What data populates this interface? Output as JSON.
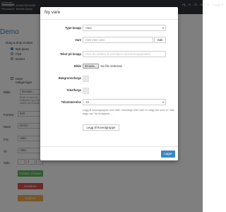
{
  "header": {
    "admin_link": "Administr...",
    "company_line": "Sentralenr.: 9100079000000",
    "firm_line": "Firmanavn: Testvirk Demo",
    "nav_text": "Hj...  K...  O...  Admin...  Logg ut"
  },
  "background": {
    "title": "Demo",
    "dragdrop_label": "Drag & drop modus",
    "radio_options": [
      "Bytt plass",
      "Flytt",
      "Endret"
    ],
    "checkbox_label_1": "Have",
    "checkbox_label_2": "redigeringer",
    "image_label": "Bilde",
    "browse_label": "Browse...",
    "image_help": "Bilder er bare for knappene og vil bli skalert med høyde",
    "format_label": "Format",
    "format_value": "9x0",
    "name_label": "Navn",
    "name_value": "Demo",
    "from_label": "Fra",
    "from_value": "Aktiv",
    "to_label": "Til",
    "to_value": "Aktiv",
    "page_label": "Side",
    "page_value": "1",
    "btn_green": "Publiser til kasse",
    "btn_red": "Deaktiver",
    "btn_yellow": "Dupliser",
    "colors": {
      "green": "#5cb85c",
      "red": "#d9534f",
      "yellow": "#f0ad4e"
    }
  },
  "modal": {
    "title": "Ny vare",
    "type_label": "Type knapp",
    "type_value": "Vare",
    "vare_label": "Vare",
    "vare_placeholder": "Søk etter vare",
    "search_button": "Søk",
    "text_label": "Tekst på knapp",
    "text_placeholder": "Hvis du ønsker å overstyre normal knappetekst",
    "image_label": "Bilde",
    "browse_label": "Browse...",
    "no_file": "No file selected.",
    "bg_color_label": "Bakgrunnsfarge",
    "text_color_label": "Tekstfarge",
    "font_size_label": "Tekststørrelse",
    "font_size_value": "10",
    "help_text": "Legg til hovedgrupper som ikke i tekstlege eller vare er valgt (Se ovre er \"Alle ekgo var\" for knappen) ...",
    "add_group_button": "Legg til hovedgruppe",
    "save_button": "Lagre",
    "accent": "#3a86c8"
  }
}
